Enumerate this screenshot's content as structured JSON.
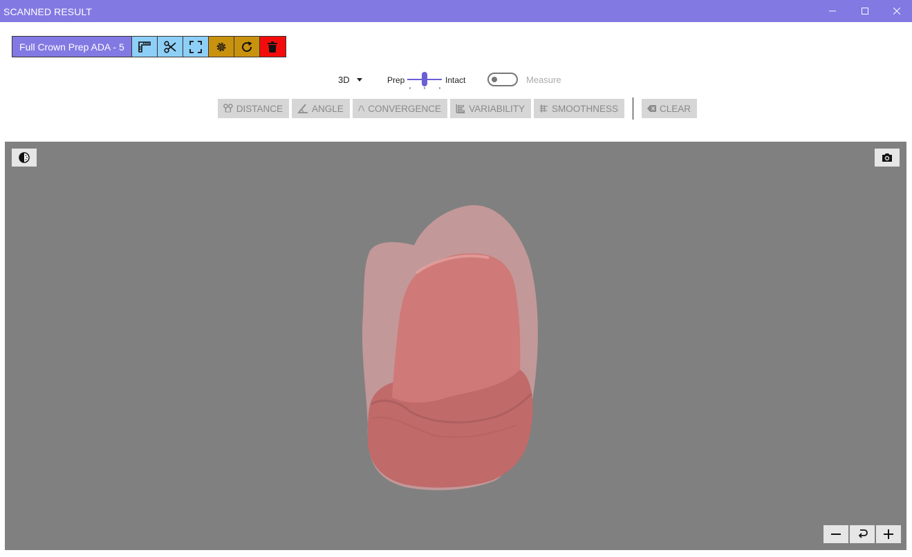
{
  "window": {
    "title": "SCANNED RESULT",
    "controls": [
      "minimize",
      "maximize",
      "close"
    ]
  },
  "toolbar": {
    "name_label": "Full Crown Prep ADA - 5",
    "buttons": [
      {
        "icon": "ruler-icon",
        "color": "#8ecff8"
      },
      {
        "icon": "scissors-icon",
        "color": "#8ecff8"
      },
      {
        "icon": "fit-view-icon",
        "color": "#8ecff8"
      },
      {
        "icon": "settings-gear-icon",
        "color": "#c9920e"
      },
      {
        "icon": "refresh-icon",
        "color": "#c9920e"
      },
      {
        "icon": "trash-icon",
        "color": "#f40c0c"
      }
    ],
    "accent_color": "#8379e3"
  },
  "view": {
    "mode_value": "3D",
    "slider_left_label": "Prep",
    "slider_right_label": "Intact",
    "measure_label": "Measure",
    "measure_enabled": false
  },
  "tools": {
    "distance": "DISTANCE",
    "angle": "ANGLE",
    "convergence": "CONVERGENCE",
    "variability": "VARIABILITY",
    "smoothness": "SMOOTHNESS",
    "clear": "CLEAR"
  },
  "viewport": {
    "background": "#808080",
    "contrast_icon": "contrast-icon",
    "screenshot_icon": "camera-icon",
    "zoom": [
      "zoom-out-icon",
      "reset-view-icon",
      "zoom-in-icon"
    ],
    "model_color": "#d98282"
  }
}
